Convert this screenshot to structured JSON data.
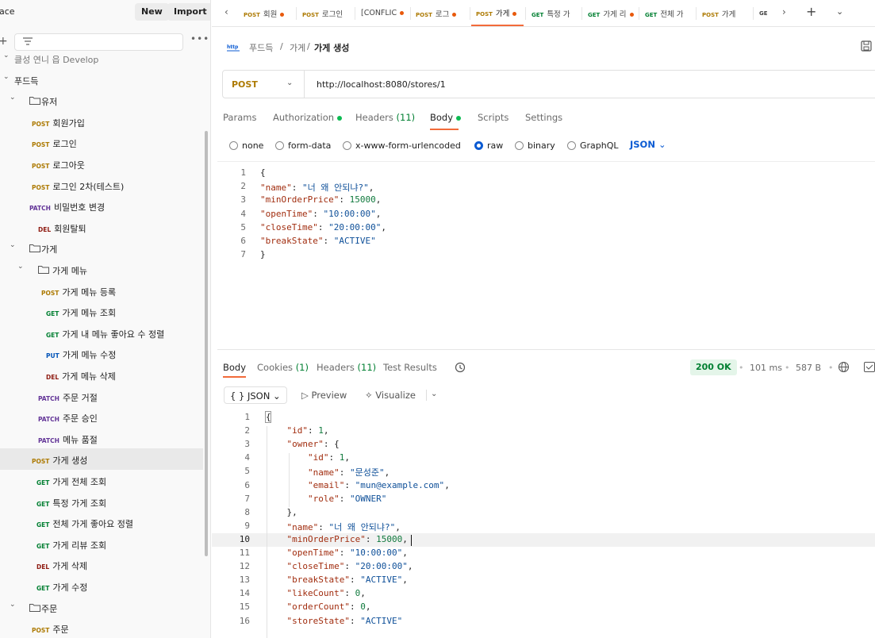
{
  "sidebar": {
    "workspace_name": "pace",
    "new_label": "New",
    "import_label": "Import",
    "more_label": "•••",
    "items": [
      {
        "label": "클성 연니 읍 Develop",
        "kind": "text"
      },
      {
        "label": "푸드득",
        "kind": "collection"
      },
      {
        "label": "유저",
        "kind": "folder"
      },
      {
        "method": "POST",
        "label": "회원가입"
      },
      {
        "method": "POST",
        "label": "로그인"
      },
      {
        "method": "POST",
        "label": "로그아웃"
      },
      {
        "method": "POST",
        "label": "로그인 2차(테스트)"
      },
      {
        "method": "PATCH",
        "label": "비밀번호 변경"
      },
      {
        "method": "DEL",
        "label": "회원탈퇴"
      },
      {
        "label": "가게",
        "kind": "folder"
      },
      {
        "label": "가게 메뉴",
        "kind": "folder"
      },
      {
        "method": "POST",
        "label": "가게 메뉴 등록"
      },
      {
        "method": "GET",
        "label": "가게 메뉴 조회"
      },
      {
        "method": "GET",
        "label": "가게 내 메뉴 좋아요 수 정렬"
      },
      {
        "method": "PUT",
        "label": "가게 메뉴 수정"
      },
      {
        "method": "DEL",
        "label": "가게 메뉴 삭제"
      },
      {
        "method": "PATCH",
        "label": "주문 거절"
      },
      {
        "method": "PATCH",
        "label": "주문 승인"
      },
      {
        "method": "PATCH",
        "label": "메뉴 품절"
      },
      {
        "method": "POST",
        "label": "가게 생성"
      },
      {
        "method": "GET",
        "label": "가게 전체 조회"
      },
      {
        "method": "GET",
        "label": "특정 가게 조회"
      },
      {
        "method": "GET",
        "label": "전체 가게 좋아요 정렬"
      },
      {
        "method": "GET",
        "label": "가게 리뷰 조회"
      },
      {
        "method": "DEL",
        "label": "가게 삭제"
      },
      {
        "method": "GET",
        "label": "가게 수정"
      },
      {
        "label": "주문",
        "kind": "folder"
      },
      {
        "method": "POST",
        "label": "주문"
      }
    ]
  },
  "tabs": [
    {
      "method": "POST",
      "label": "회원",
      "dot": true
    },
    {
      "method": "POST",
      "label": "로그인",
      "dot": false
    },
    {
      "method": "",
      "label": "[CONFLIC",
      "dot": true
    },
    {
      "method": "POST",
      "label": "로그",
      "dot": true
    },
    {
      "method": "POST",
      "label": "가게",
      "dot": true
    },
    {
      "method": "GET",
      "label": "특정 가",
      "dot": false
    },
    {
      "method": "GET",
      "label": "가게 리",
      "dot": true
    },
    {
      "method": "GET",
      "label": "전체 가",
      "dot": false
    },
    {
      "method": "POST",
      "label": "가게 ",
      "dot": false
    },
    {
      "method": "GE",
      "label": "",
      "dot": false
    }
  ],
  "breadcrumb": {
    "part1": "푸드득",
    "sep": "/",
    "part2": "가게",
    "part3": "가게 생성"
  },
  "request": {
    "method": "POST",
    "url": "http://localhost:8080/stores/1",
    "tabs": {
      "params": "Params",
      "authorization": "Authorization",
      "headers": "Headers",
      "headers_count": "(11)",
      "body": "Body",
      "scripts": "Scripts",
      "settings": "Settings"
    },
    "body_types": [
      "none",
      "form-data",
      "x-www-form-urlencoded",
      "raw",
      "binary",
      "GraphQL"
    ],
    "selected_body_type": "raw",
    "format": "JSON",
    "body_lines": [
      "{",
      "\"name\": \"너 왜 안되냐?\",",
      "\"minOrderPrice\": 15000,",
      "\"openTime\": \"10:00:00\",",
      "\"closeTime\": \"20:00:00\",",
      "\"breakState\": \"ACTIVE\"",
      "}"
    ]
  },
  "response": {
    "tabs": {
      "body": "Body",
      "cookies": "Cookies",
      "cookies_count": "(1)",
      "headers": "Headers",
      "headers_count": "(11)",
      "test_results": "Test Results"
    },
    "status": "200 OK",
    "time": "101 ms",
    "size": "587 B",
    "view_format": "JSON",
    "preview_label": "Preview",
    "visualize_label": "Visualize",
    "lines": [
      "{",
      "    \"id\": 1,",
      "    \"owner\": {",
      "        \"id\": 1,",
      "        \"name\": \"문성준\",",
      "        \"email\": \"mun@example.com\",",
      "        \"role\": \"OWNER\"",
      "    },",
      "    \"name\": \"너 왜 안되냐?\",",
      "    \"minOrderPrice\": 15000,",
      "    \"openTime\": \"10:00:00\",",
      "    \"closeTime\": \"20:00:00\",",
      "    \"breakState\": \"ACTIVE\",",
      "    \"likeCount\": 0,",
      "    \"orderCount\": 0,",
      "    \"storeState\": \"ACTIVE\""
    ]
  },
  "colors": {
    "accent": "#f26b3a",
    "post": "#ad7a03",
    "get": "#007f31",
    "patch": "#623497",
    "put": "#0053b8",
    "del": "#8e1a10",
    "status_ok": "#007f31"
  }
}
